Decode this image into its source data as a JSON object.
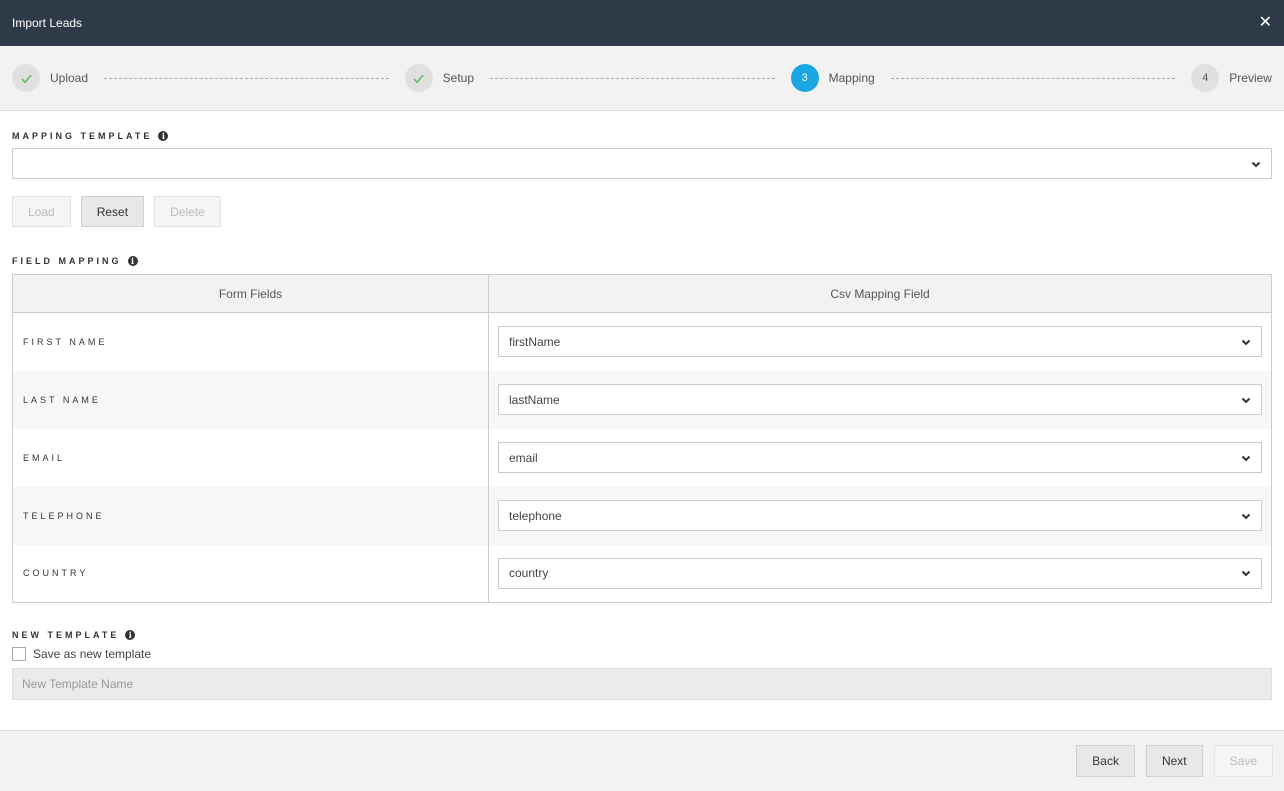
{
  "window": {
    "title": "Import Leads",
    "close_label": "✕"
  },
  "steps": [
    {
      "label": "Upload",
      "state": "done",
      "marker": ""
    },
    {
      "label": "Setup",
      "state": "done",
      "marker": ""
    },
    {
      "label": "Mapping",
      "state": "active",
      "marker": "3"
    },
    {
      "label": "Preview",
      "state": "pending",
      "marker": "4"
    }
  ],
  "mapping_template": {
    "title": "MAPPING TEMPLATE",
    "info_glyph": "i",
    "selected": "",
    "buttons": {
      "load": "Load",
      "reset": "Reset",
      "delete": "Delete"
    }
  },
  "field_mapping": {
    "title": "FIELD MAPPING",
    "info_glyph": "i",
    "headers": {
      "form_fields": "Form Fields",
      "csv_field": "Csv Mapping Field"
    },
    "rows": [
      {
        "field": "FIRST NAME",
        "csv": "firstName"
      },
      {
        "field": "LAST NAME",
        "csv": "lastName"
      },
      {
        "field": "EMAIL",
        "csv": "email"
      },
      {
        "field": "TELEPHONE",
        "csv": "telephone"
      },
      {
        "field": "COUNTRY",
        "csv": "country"
      }
    ]
  },
  "new_template": {
    "title": "NEW TEMPLATE",
    "info_glyph": "i",
    "checkbox_label": "Save as new template",
    "checked": false,
    "name_placeholder": "New Template Name"
  },
  "footer": {
    "back": "Back",
    "next": "Next",
    "save": "Save"
  },
  "colors": {
    "titlebar": "#2e3a48",
    "accent": "#1aa6e4",
    "check": "#5cb85c"
  }
}
